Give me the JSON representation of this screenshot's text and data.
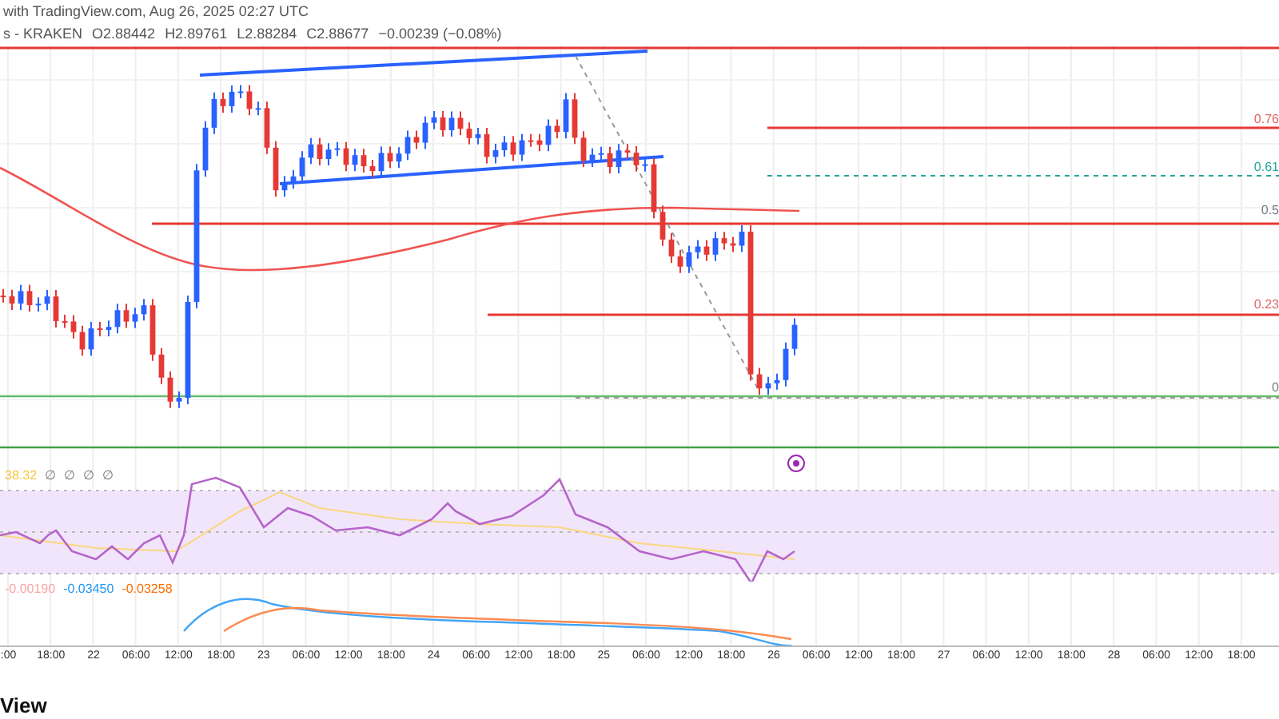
{
  "header": {
    "title": "with TradingView.com, Aug 26, 2025 02:27 UTC"
  },
  "legend": {
    "symbol": "s - KRAKEN",
    "values": [
      "O2.88442",
      "H2.89761",
      "L2.88284",
      "C2.88677",
      "−0.00239 (−0.08%)"
    ]
  },
  "fib_levels": [
    {
      "label": "0.76",
      "color": "#e06666"
    },
    {
      "label": "0.61",
      "color": "#26a69a"
    },
    {
      "label": "0.5",
      "color": "#787b86"
    },
    {
      "label": "0.23",
      "color": "#e06666"
    },
    {
      "label": "0",
      "color": "#787b86"
    }
  ],
  "rsi": {
    "value": "38.32",
    "flags": [
      "∅",
      "∅",
      "∅",
      "∅"
    ]
  },
  "macd": {
    "values": [
      {
        "text": "-0.00190",
        "color": "#f7a5a5"
      },
      {
        "text": "-0.03450",
        "color": "#2196f3"
      },
      {
        "text": "-0.03258",
        "color": "#ff6d00"
      }
    ]
  },
  "x_axis": {
    "labels": [
      ":00",
      "18:00",
      "22",
      "06:00",
      "12:00",
      "18:00",
      "23",
      "06:00",
      "12:00",
      "18:00",
      "24",
      "06:00",
      "12:00",
      "18:00",
      "25",
      "06:00",
      "12:00",
      "18:00",
      "26",
      "06:00",
      "12:00",
      "18:00",
      "27",
      "06:00",
      "12:00",
      "18:00",
      "28",
      "06:00",
      "12:00",
      "18:00"
    ]
  },
  "footer": {
    "text": "View"
  }
}
